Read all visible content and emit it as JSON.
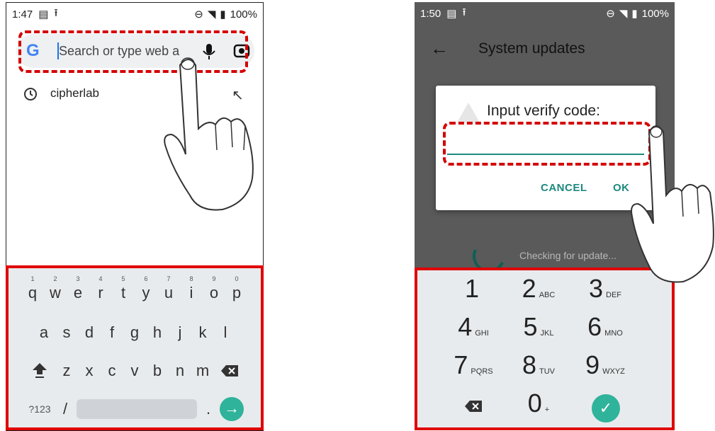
{
  "left_phone": {
    "status": {
      "time": "1:47",
      "battery": "100%"
    },
    "search": {
      "placeholder": "Search or type web a"
    },
    "suggestion": {
      "text": "cipherlab"
    },
    "keyboard": {
      "row1": [
        {
          "k": "q",
          "n": "1"
        },
        {
          "k": "w",
          "n": "2"
        },
        {
          "k": "e",
          "n": "3"
        },
        {
          "k": "r",
          "n": "4"
        },
        {
          "k": "t",
          "n": "5"
        },
        {
          "k": "y",
          "n": "6"
        },
        {
          "k": "u",
          "n": "7"
        },
        {
          "k": "i",
          "n": "8"
        },
        {
          "k": "o",
          "n": "9"
        },
        {
          "k": "p",
          "n": "0"
        }
      ],
      "row2": [
        "a",
        "s",
        "d",
        "f",
        "g",
        "h",
        "j",
        "k",
        "l"
      ],
      "row3": [
        "z",
        "x",
        "c",
        "v",
        "b",
        "n",
        "m"
      ],
      "symbols_key": "?123",
      "slash_key": "/",
      "period_key": "."
    }
  },
  "right_phone": {
    "status": {
      "time": "1:50",
      "battery": "100%"
    },
    "appbar_title": "System updates",
    "dialog": {
      "title": "Input verify code:",
      "cancel": "CANCEL",
      "ok": "OK"
    },
    "checking_text": "Checking for update...",
    "numpad": [
      {
        "d": "1",
        "l": ""
      },
      {
        "d": "2",
        "l": "ABC"
      },
      {
        "d": "3",
        "l": "DEF"
      },
      {
        "d": "4",
        "l": "GHI"
      },
      {
        "d": "5",
        "l": "JKL"
      },
      {
        "d": "6",
        "l": "MNO"
      },
      {
        "d": "7",
        "l": "PQRS"
      },
      {
        "d": "8",
        "l": "TUV"
      },
      {
        "d": "9",
        "l": "WXYZ"
      },
      {
        "d": "0",
        "l": "+"
      }
    ]
  },
  "colors": {
    "accent": "#2fb39a",
    "highlight_red": "#e00000",
    "dialog_teal": "#1d8a7f"
  }
}
